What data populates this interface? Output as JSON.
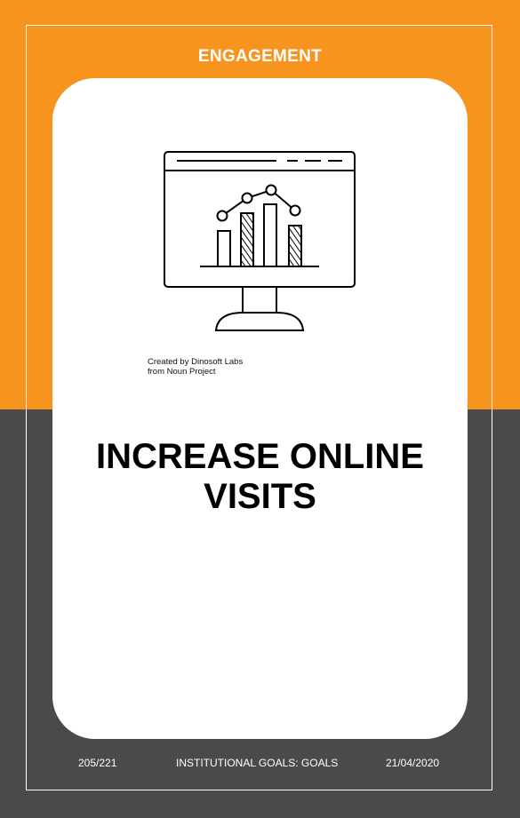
{
  "header": {
    "category": "ENGAGEMENT"
  },
  "card": {
    "icon": "monitor-chart-icon",
    "credit_line1": "Created by Dinosoft Labs",
    "credit_line2": "from Noun Project",
    "title_line1": "INCREASE ONLINE",
    "title_line2": "VISITS"
  },
  "footer": {
    "page": "205/221",
    "section": "INSTITUTIONAL GOALS: GOALS",
    "date": "21/04/2020"
  },
  "colors": {
    "accent_orange": "#f7941d",
    "dark_gray": "#4a4a4c",
    "card_white": "#ffffff"
  }
}
